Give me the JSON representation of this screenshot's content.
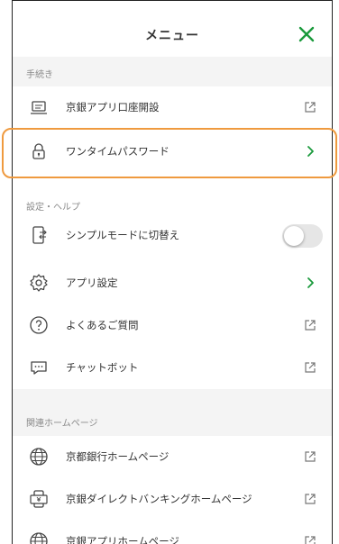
{
  "header": {
    "title": "メニュー",
    "close_icon": "close-icon"
  },
  "colors": {
    "accent": "#1a9a3c",
    "highlight": "#ef9a3f",
    "section_bg": "#f4f4f4"
  },
  "sections": {
    "procedures": {
      "label": "手続き",
      "items": [
        {
          "label": "京銀アプリ口座開設",
          "icon": "laptop-icon",
          "trailing": "external-link-icon"
        },
        {
          "label": "ワンタイムパスワード",
          "icon": "lock-icon",
          "trailing": "chevron-right-icon"
        }
      ]
    },
    "settings": {
      "label": "設定・ヘルプ",
      "items": [
        {
          "label": "シンプルモードに切替え",
          "icon": "phone-switch-icon",
          "trailing": "toggle",
          "toggle_on": false
        },
        {
          "label": "アプリ設定",
          "icon": "gear-icon",
          "trailing": "chevron-right-icon"
        },
        {
          "label": "よくあるご質問",
          "icon": "question-icon",
          "trailing": "external-link-icon"
        },
        {
          "label": "チャットボット",
          "icon": "chat-icon",
          "trailing": "external-link-icon"
        }
      ]
    },
    "links": {
      "label": "関連ホームページ",
      "items": [
        {
          "label": "京都銀行ホームページ",
          "icon": "globe-icon",
          "trailing": "external-link-icon"
        },
        {
          "label": "京銀ダイレクトバンキングホームページ",
          "icon": "phone-yen-icon",
          "trailing": "external-link-icon"
        },
        {
          "label": "京銀アプリホームページ",
          "icon": "globe-icon",
          "trailing": "external-link-icon"
        }
      ]
    }
  }
}
